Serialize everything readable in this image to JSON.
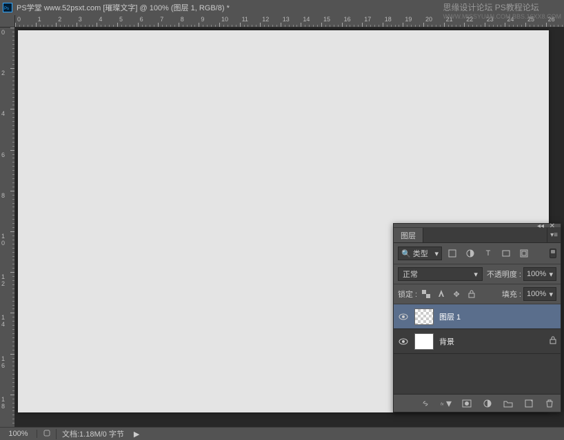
{
  "title": "PS学堂  www.52psxt.com [璀璨文字] @ 100% (图层 1, RGB/8) *",
  "watermark": {
    "line1": "思缘设计论坛   PS教程论坛",
    "line2": "WWW.MISSYUAN.COM     BBS.16XX8.COM"
  },
  "status": {
    "zoom": "100%",
    "doc_info": "文档:1.18M/0 字节"
  },
  "ruler_h": [
    0,
    1,
    2,
    3,
    4,
    5,
    6,
    7,
    8,
    9,
    10,
    11,
    12,
    13,
    14,
    15,
    16,
    17,
    18,
    19,
    20,
    21,
    22,
    23,
    24,
    25,
    26
  ],
  "ruler_v": [
    0,
    2,
    4,
    6,
    8,
    10,
    12,
    14,
    16,
    18
  ],
  "panel": {
    "tab": "图层",
    "filter_label": "类型",
    "blend_mode": "正常",
    "opacity_label": "不透明度 :",
    "opacity_value": "100%",
    "lock_label": "锁定 :",
    "fill_label": "填充 :",
    "fill_value": "100%",
    "layers": [
      {
        "name": "图层 1",
        "selected": true,
        "locked": false,
        "checker": true
      },
      {
        "name": "背景",
        "selected": false,
        "locked": true,
        "checker": false
      }
    ]
  }
}
